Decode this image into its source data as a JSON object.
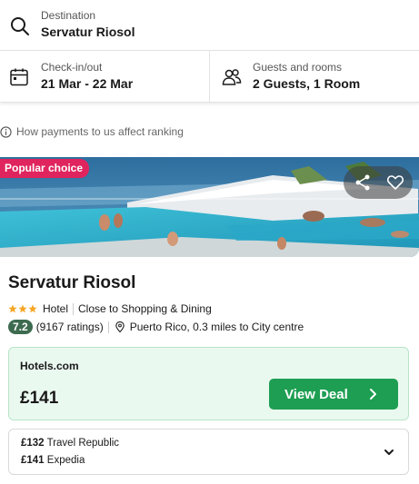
{
  "search": {
    "destination_label": "Destination",
    "destination_value": "Servatur Riosol",
    "dates_label": "Check-in/out",
    "dates_value": "21 Mar - 22 Mar",
    "guests_label": "Guests and rooms",
    "guests_value": "2 Guests, 1 Room"
  },
  "ranking_link": "How payments to us affect ranking",
  "hotel": {
    "badge": "Popular choice",
    "name": "Servatur Riosol",
    "stars": 3,
    "type": "Hotel",
    "feature": "Close to Shopping & Dining",
    "score": "7.2",
    "ratings": "(9167 ratings)",
    "location": "Puerto Rico, 0.3 miles to City centre"
  },
  "deal": {
    "provider": "Hotels.com",
    "price": "£141",
    "button_label": "View Deal"
  },
  "other_deals": [
    {
      "price": "£132",
      "provider": "Travel Republic"
    },
    {
      "price": "£141",
      "provider": "Expedia"
    }
  ],
  "icons": {
    "destination": "search-icon",
    "dates": "calendar-icon",
    "guests": "people-icon",
    "ranking": "info-icon",
    "share": "share-icon",
    "save": "heart-icon",
    "location": "location-pin-icon",
    "view_deal": "chevron-right-icon",
    "expand": "chevron-down-icon"
  },
  "colors": {
    "badge": "#e0245e",
    "score": "#3d6b4f",
    "deal_bg": "#eaf9f0",
    "deal_button": "#1e9e52",
    "star": "#f5a623"
  }
}
